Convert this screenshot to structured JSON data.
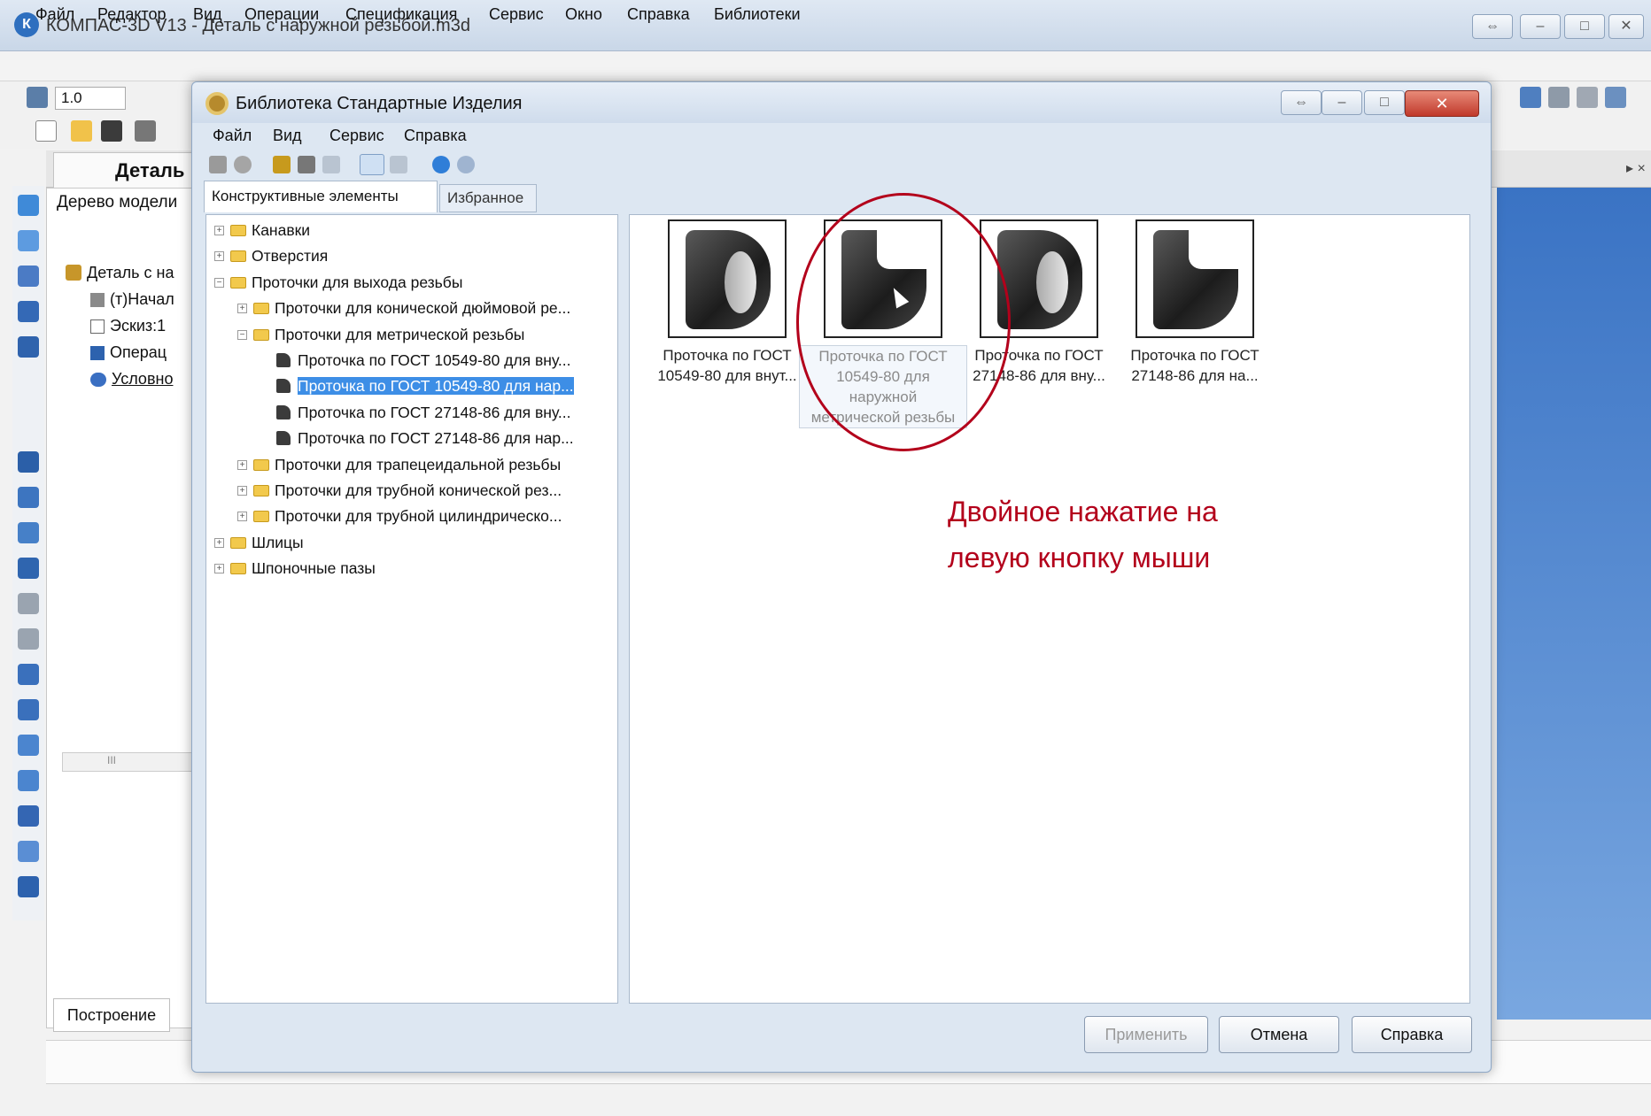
{
  "app": {
    "title": "КОМПАС-3D V13 - Деталь с наружной резьбой.m3d",
    "logo": "К",
    "menu": [
      "Файл",
      "Редактор",
      "Вид",
      "Операции",
      "Спецификация",
      "Сервис",
      "Окно",
      "Справка",
      "Библиотеки"
    ],
    "toolbar_zoom_value": "1.0",
    "doc_tab_label": "Деталь",
    "doc_tab_close": "▸ ×",
    "tree_panel_title": "Дерево модели",
    "tree_items": [
      "Деталь с на",
      "(т)Начал",
      "Эскиз:1",
      "Операц",
      "Условно"
    ],
    "build_tab_label": "Построение",
    "scroll_glyph": "III"
  },
  "dialog": {
    "title": "Библиотека Стандартные Изделия",
    "menu": [
      "Файл",
      "Вид",
      "Сервис",
      "Справка"
    ],
    "tabs": {
      "elements": "Конструктивные элементы",
      "favorites": "Избранное"
    },
    "tree": [
      {
        "label": "Канавки",
        "level": 0,
        "type": "folder",
        "exp": "+"
      },
      {
        "label": "Отверстия",
        "level": 0,
        "type": "folder",
        "exp": "+"
      },
      {
        "label": "Проточки для выхода резьбы",
        "level": 0,
        "type": "folder",
        "exp": "−"
      },
      {
        "label": "Проточки для конической дюймовой ре...",
        "level": 1,
        "type": "folder",
        "exp": "+"
      },
      {
        "label": "Проточки для метрической резьбы",
        "level": 1,
        "type": "folder",
        "exp": "−"
      },
      {
        "label": "Проточка по ГОСТ 10549-80 для вну...",
        "level": 2,
        "type": "part"
      },
      {
        "label": "Проточка по ГОСТ 10549-80 для нар...",
        "level": 2,
        "type": "part",
        "selected": true
      },
      {
        "label": "Проточка по ГОСТ 27148-86 для вну...",
        "level": 2,
        "type": "part"
      },
      {
        "label": "Проточка по ГОСТ 27148-86 для нар...",
        "level": 2,
        "type": "part"
      },
      {
        "label": "Проточки для трапецеидальной резьбы",
        "level": 1,
        "type": "folder",
        "exp": "+"
      },
      {
        "label": "Проточки для трубной конической рез...",
        "level": 1,
        "type": "folder",
        "exp": "+"
      },
      {
        "label": "Проточки для трубной цилиндрическо...",
        "level": 1,
        "type": "folder",
        "exp": "+"
      },
      {
        "label": "Шлицы",
        "level": 0,
        "type": "folder",
        "exp": "+"
      },
      {
        "label": "Шпоночные пазы",
        "level": 0,
        "type": "folder",
        "exp": "+"
      }
    ],
    "thumbnails": [
      {
        "caption1": "Проточка по ГОСТ",
        "caption2": "10549-80 для внут...",
        "shape": "inner"
      },
      {
        "caption1": "Проточка по ГОСТ",
        "caption2": "10549-80 для",
        "caption3": "наружной",
        "caption4": "метрической резьбы",
        "shape": "outer",
        "hover": true
      },
      {
        "caption1": "Проточка по ГОСТ",
        "caption2": "27148-86 для вну...",
        "shape": "inner"
      },
      {
        "caption1": "Проточка по ГОСТ",
        "caption2": "27148-86 для на...",
        "shape": "outer"
      }
    ],
    "annotation": {
      "line1": "Двойное нажатие на",
      "line2": "левую кнопку мыши"
    },
    "buttons": {
      "apply": "Применить",
      "cancel": "Отмена",
      "help": "Справка"
    }
  },
  "colors": {
    "accent": "#3d8ee6",
    "annotation": "#b3001b",
    "viewport": "#3a73c4"
  },
  "glyphs": {
    "minimize": "–",
    "maximize": "□",
    "close": "✕",
    "restore": "⇔"
  }
}
